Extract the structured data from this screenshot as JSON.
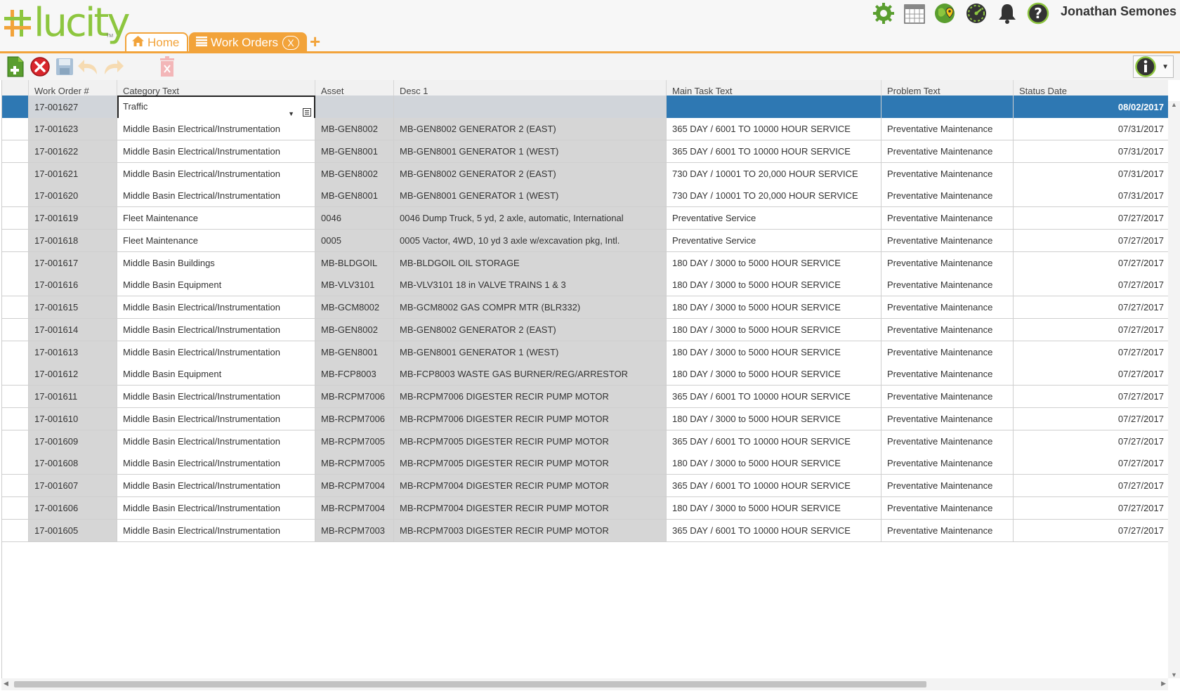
{
  "app": {
    "logo_text": "lucity",
    "user_name": "Jonathan Semones"
  },
  "tabs": {
    "home_label": "Home",
    "work_orders_label": "Work Orders",
    "close_label": "X",
    "add_label": "+"
  },
  "colors": {
    "accent": "#f2a33a",
    "brand_green": "#8dc63f",
    "selected_row": "#2e78b3"
  },
  "top_icons": [
    "settings-icon",
    "calendar-icon",
    "map-icon",
    "dashboard-icon",
    "notifications-icon",
    "help-icon"
  ],
  "toolbar": {
    "buttons": [
      "new-record-icon",
      "cancel-icon",
      "save-icon",
      "undo-icon",
      "redo-icon",
      "delete-icon"
    ],
    "info_icon": "info-icon"
  },
  "grid": {
    "columns": [
      "Work Order #",
      "Category Text",
      "Asset",
      "Desc 1",
      "Main Task Text",
      "Problem Text",
      "Status Date"
    ],
    "selected_row": {
      "work_order": "17-001627",
      "category_edit_value": "Traffic",
      "asset": "",
      "desc1": "",
      "main_task": "",
      "problem": "",
      "status_date": "08/02/2017"
    },
    "rows": [
      {
        "wo": "17-001623",
        "cat": "Middle Basin Electrical/Instrumentation",
        "asset": "MB-GEN8002",
        "desc": "MB-GEN8002 GENERATOR 2 (EAST)",
        "task": "365 DAY / 6001 TO 10000 HOUR SERVICE",
        "problem": "Preventative Maintenance",
        "date": "07/31/2017"
      },
      {
        "wo": "17-001622",
        "cat": "Middle Basin Electrical/Instrumentation",
        "asset": "MB-GEN8001",
        "desc": "MB-GEN8001 GENERATOR 1 (WEST)",
        "task": "365 DAY / 6001 TO 10000 HOUR SERVICE",
        "problem": "Preventative Maintenance",
        "date": "07/31/2017"
      },
      {
        "wo": "17-001621",
        "cat": "Middle Basin Electrical/Instrumentation",
        "asset": "MB-GEN8002",
        "desc": "MB-GEN8002 GENERATOR 2 (EAST)",
        "task": "730 DAY / 10001 TO 20,000 HOUR SERVICE",
        "problem": "Preventative Maintenance",
        "date": "07/31/2017"
      },
      {
        "wo": "17-001620",
        "cat": "Middle Basin Electrical/Instrumentation",
        "asset": "MB-GEN8001",
        "desc": "MB-GEN8001 GENERATOR 1 (WEST)",
        "task": "730 DAY / 10001 TO 20,000 HOUR SERVICE",
        "problem": "Preventative Maintenance",
        "date": "07/31/2017"
      },
      {
        "wo": "17-001619",
        "cat": "Fleet Maintenance",
        "asset": "0046",
        "desc": "0046 Dump Truck, 5 yd, 2 axle, automatic, International",
        "task": "Preventative Service",
        "problem": "Preventative Maintenance",
        "date": "07/27/2017"
      },
      {
        "wo": "17-001618",
        "cat": "Fleet Maintenance",
        "asset": "0005",
        "desc": "0005 Vactor, 4WD, 10 yd 3 axle w/excavation pkg, Intl.",
        "task": "Preventative Service",
        "problem": "Preventative Maintenance",
        "date": "07/27/2017"
      },
      {
        "wo": "17-001617",
        "cat": "Middle Basin Buildings",
        "asset": "MB-BLDGOIL",
        "desc": "MB-BLDGOIL OIL STORAGE",
        "task": "180 DAY / 3000 to 5000 HOUR SERVICE",
        "problem": "Preventative Maintenance",
        "date": "07/27/2017"
      },
      {
        "wo": "17-001616",
        "cat": "Middle Basin Equipment",
        "asset": "MB-VLV3101",
        "desc": "MB-VLV3101 18 in VALVE TRAINS 1 & 3",
        "task": "180 DAY / 3000 to 5000 HOUR SERVICE",
        "problem": "Preventative Maintenance",
        "date": "07/27/2017"
      },
      {
        "wo": "17-001615",
        "cat": "Middle Basin Electrical/Instrumentation",
        "asset": "MB-GCM8002",
        "desc": "MB-GCM8002 GAS COMPR MTR (BLR332)",
        "task": "180 DAY / 3000 to 5000 HOUR SERVICE",
        "problem": "Preventative Maintenance",
        "date": "07/27/2017"
      },
      {
        "wo": "17-001614",
        "cat": "Middle Basin Electrical/Instrumentation",
        "asset": "MB-GEN8002",
        "desc": "MB-GEN8002 GENERATOR 2 (EAST)",
        "task": "180 DAY / 3000 to 5000 HOUR SERVICE",
        "problem": "Preventative Maintenance",
        "date": "07/27/2017"
      },
      {
        "wo": "17-001613",
        "cat": "Middle Basin Electrical/Instrumentation",
        "asset": "MB-GEN8001",
        "desc": "MB-GEN8001 GENERATOR 1 (WEST)",
        "task": "180 DAY / 3000 to 5000 HOUR SERVICE",
        "problem": "Preventative Maintenance",
        "date": "07/27/2017"
      },
      {
        "wo": "17-001612",
        "cat": "Middle Basin Equipment",
        "asset": "MB-FCP8003",
        "desc": "MB-FCP8003 WASTE GAS BURNER/REG/ARRESTOR",
        "task": "180 DAY / 3000 to 5000 HOUR SERVICE",
        "problem": "Preventative Maintenance",
        "date": "07/27/2017"
      },
      {
        "wo": "17-001611",
        "cat": "Middle Basin Electrical/Instrumentation",
        "asset": "MB-RCPM7006",
        "desc": "MB-RCPM7006 DIGESTER RECIR PUMP MOTOR",
        "task": "365 DAY / 6001 TO 10000 HOUR SERVICE",
        "problem": "Preventative Maintenance",
        "date": "07/27/2017"
      },
      {
        "wo": "17-001610",
        "cat": "Middle Basin Electrical/Instrumentation",
        "asset": "MB-RCPM7006",
        "desc": "MB-RCPM7006 DIGESTER RECIR PUMP MOTOR",
        "task": "180 DAY / 3000 to 5000 HOUR SERVICE",
        "problem": "Preventative Maintenance",
        "date": "07/27/2017"
      },
      {
        "wo": "17-001609",
        "cat": "Middle Basin Electrical/Instrumentation",
        "asset": "MB-RCPM7005",
        "desc": "MB-RCPM7005 DIGESTER RECIR PUMP MOTOR",
        "task": "365 DAY / 6001 TO 10000 HOUR SERVICE",
        "problem": "Preventative Maintenance",
        "date": "07/27/2017"
      },
      {
        "wo": "17-001608",
        "cat": "Middle Basin Electrical/Instrumentation",
        "asset": "MB-RCPM7005",
        "desc": "MB-RCPM7005 DIGESTER RECIR PUMP MOTOR",
        "task": "180 DAY / 3000 to 5000 HOUR SERVICE",
        "problem": "Preventative Maintenance",
        "date": "07/27/2017"
      },
      {
        "wo": "17-001607",
        "cat": "Middle Basin Electrical/Instrumentation",
        "asset": "MB-RCPM7004",
        "desc": "MB-RCPM7004 DIGESTER RECIR PUMP MOTOR",
        "task": "365 DAY / 6001 TO 10000 HOUR SERVICE",
        "problem": "Preventative Maintenance",
        "date": "07/27/2017"
      },
      {
        "wo": "17-001606",
        "cat": "Middle Basin Electrical/Instrumentation",
        "asset": "MB-RCPM7004",
        "desc": "MB-RCPM7004 DIGESTER RECIR PUMP MOTOR",
        "task": "180 DAY / 3000 to 5000 HOUR SERVICE",
        "problem": "Preventative Maintenance",
        "date": "07/27/2017"
      },
      {
        "wo": "17-001605",
        "cat": "Middle Basin Electrical/Instrumentation",
        "asset": "MB-RCPM7003",
        "desc": "MB-RCPM7003 DIGESTER RECIR PUMP MOTOR",
        "task": "365 DAY / 6001 TO 10000 HOUR SERVICE",
        "problem": "Preventative Maintenance",
        "date": "07/27/2017"
      }
    ]
  }
}
